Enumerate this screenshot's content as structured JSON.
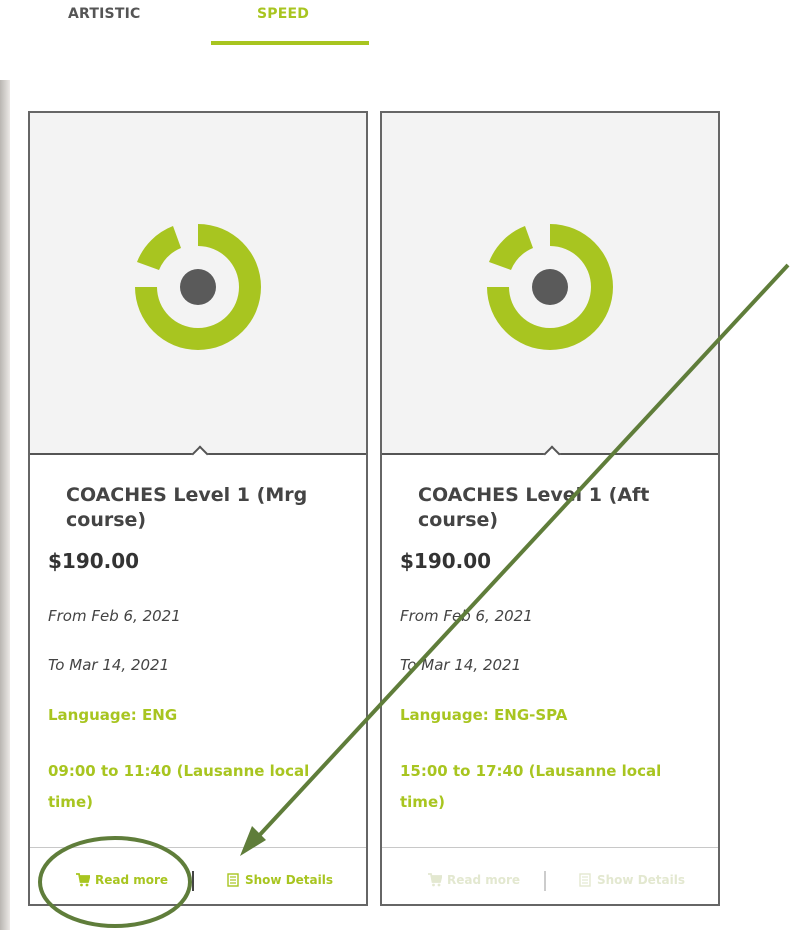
{
  "tabs": [
    {
      "label": "ARTISTIC",
      "active": false
    },
    {
      "label": "SPEED",
      "active": true
    }
  ],
  "colors": {
    "accent": "#a8c520",
    "annotation": "#5f7d3a",
    "dot": "#5a5a5a"
  },
  "cards": [
    {
      "title": "COACHES Level 1 (Mrg course)",
      "price": "$190.00",
      "from": "From Feb 6, 2021",
      "to": "To Mar 14, 2021",
      "language": "Language: ENG",
      "time": "09:00 to 11:40 (Lausanne local time)",
      "read_more": "Read more",
      "show_details": "Show Details",
      "buttons_enabled": true
    },
    {
      "title": "COACHES Level 1 (Aft course)",
      "price": "$190.00",
      "from": "From Feb 6, 2021",
      "to": "To Mar 14, 2021",
      "language": "Language: ENG-SPA",
      "time": "15:00 to 17:40 (Lausanne local time)",
      "read_more": "Read more",
      "show_details": "Show Details",
      "buttons_enabled": false
    }
  ],
  "icons": {
    "cart": "cart-icon",
    "details": "document-icon",
    "logo": "logo-ring-icon"
  }
}
